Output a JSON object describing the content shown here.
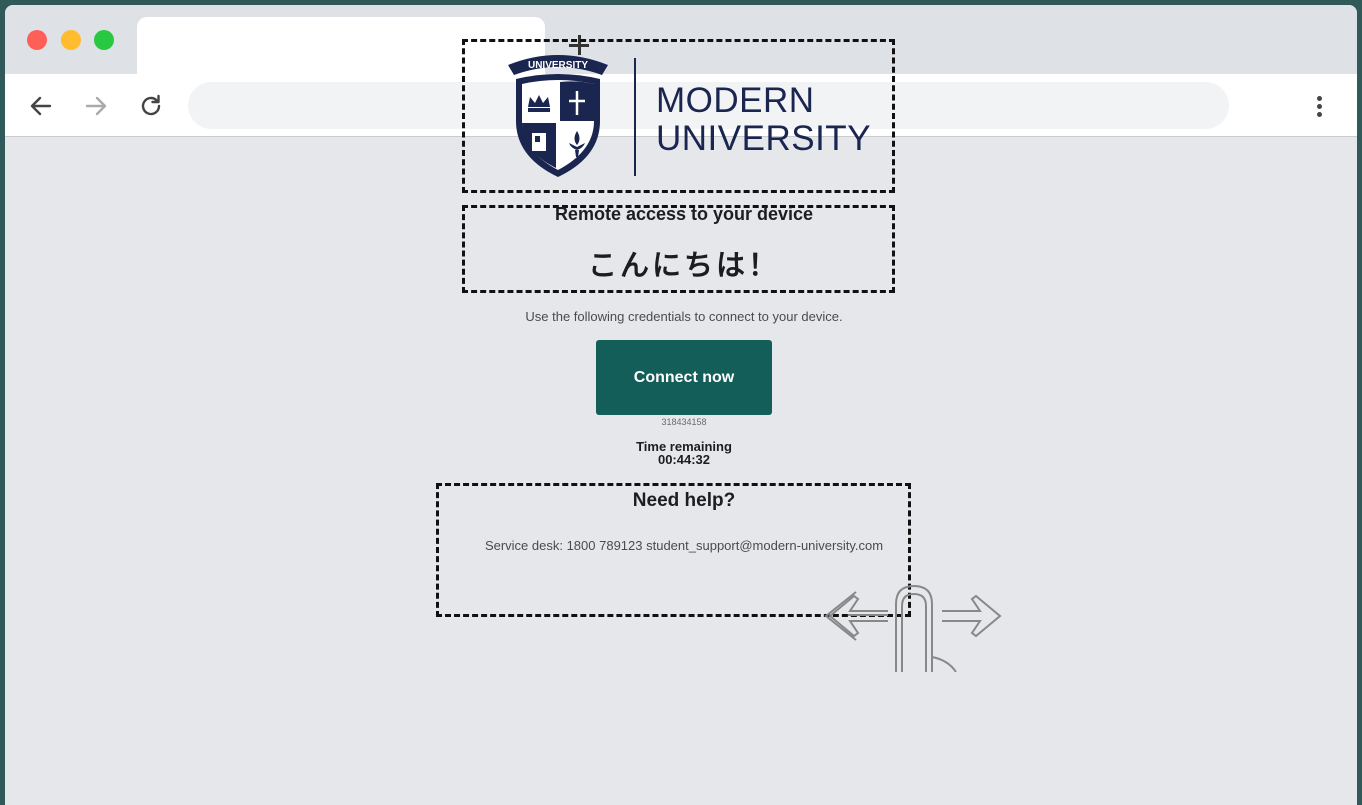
{
  "browser": {
    "tab_title": "",
    "address": "",
    "new_tab_label": "+"
  },
  "logo": {
    "name_line1": "MODERN",
    "name_line2": "UNIVERSITY",
    "banner_text": "UNIVERSITY",
    "color": "#1a2550"
  },
  "main": {
    "subtitle": "Remote access to your device",
    "greeting": "こんにちは！",
    "instructions": "Use the following credentials to connect to your device.",
    "connect_button": "Connect now",
    "session_code": "318434158",
    "time_label": "Time remaining",
    "time_value": "00:44:32"
  },
  "help": {
    "title": "Need help?",
    "contact": "Service desk: 1800 789123 student_support@modern-university.com"
  },
  "icons": [
    "back-arrow-icon",
    "forward-arrow-icon",
    "reload-icon",
    "menu-dots-icon",
    "swipe-gesture-icon",
    "university-crest-icon"
  ],
  "colors": {
    "accent": "#135e58",
    "background": "#e6e7eb",
    "frame": "#2f5a59"
  }
}
